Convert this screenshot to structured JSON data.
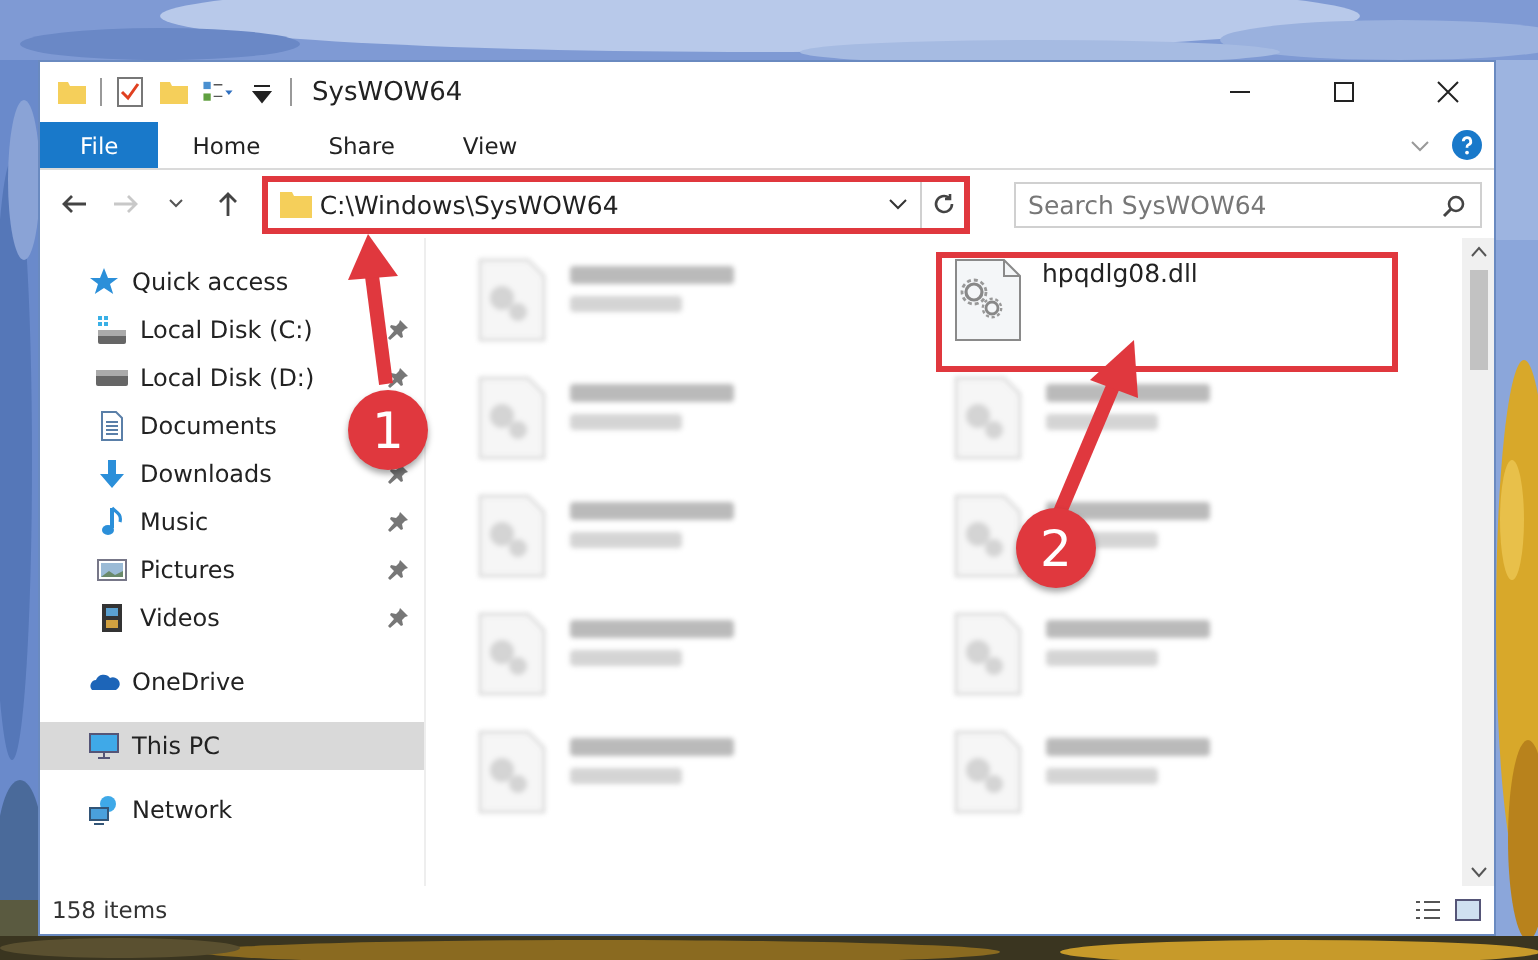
{
  "window": {
    "title": "SysWOW64"
  },
  "ribbon_tabs": [
    {
      "label": "File",
      "selected": true
    },
    {
      "label": "Home",
      "selected": false
    },
    {
      "label": "Share",
      "selected": false
    },
    {
      "label": "View",
      "selected": false
    }
  ],
  "address_bar": {
    "path": "C:\\Windows\\SysWOW64",
    "outlined": true
  },
  "search": {
    "placeholder": "Search SysWOW64"
  },
  "sidebar": {
    "items": [
      {
        "label": "Quick access",
        "kind": "star",
        "selected": false,
        "children": [
          {
            "label": "Local Disk (C:)",
            "kind": "drive-system",
            "pinned": true,
            "selected": false
          },
          {
            "label": "Local Disk (D:)",
            "kind": "drive",
            "pinned": true,
            "selected": false
          },
          {
            "label": "Documents",
            "kind": "documents",
            "selected": false
          },
          {
            "label": "Downloads",
            "kind": "downloads",
            "pinned": true,
            "selected": false
          },
          {
            "label": "Music",
            "kind": "music",
            "pinned": true,
            "selected": false
          },
          {
            "label": "Pictures",
            "kind": "pictures",
            "pinned": true,
            "selected": false
          },
          {
            "label": "Videos",
            "kind": "videos",
            "pinned": true,
            "selected": false
          }
        ]
      },
      {
        "label": "OneDrive",
        "kind": "cloud",
        "selected": false
      },
      {
        "label": "This PC",
        "kind": "pc",
        "selected": true
      },
      {
        "label": "Network",
        "kind": "network",
        "selected": false
      }
    ]
  },
  "files": [
    {
      "kind": "blurred"
    },
    {
      "kind": "file",
      "name": "hpqdlg08.dll",
      "outlined": true
    },
    {
      "kind": "blurred"
    },
    {
      "kind": "blurred"
    },
    {
      "kind": "blurred"
    },
    {
      "kind": "blurred"
    },
    {
      "kind": "blurred"
    },
    {
      "kind": "blurred"
    },
    {
      "kind": "blurred"
    },
    {
      "kind": "blurred"
    }
  ],
  "status_bar": {
    "item_count": "158 items"
  },
  "annotations": [
    {
      "label": "1"
    },
    {
      "label": "2"
    }
  ]
}
